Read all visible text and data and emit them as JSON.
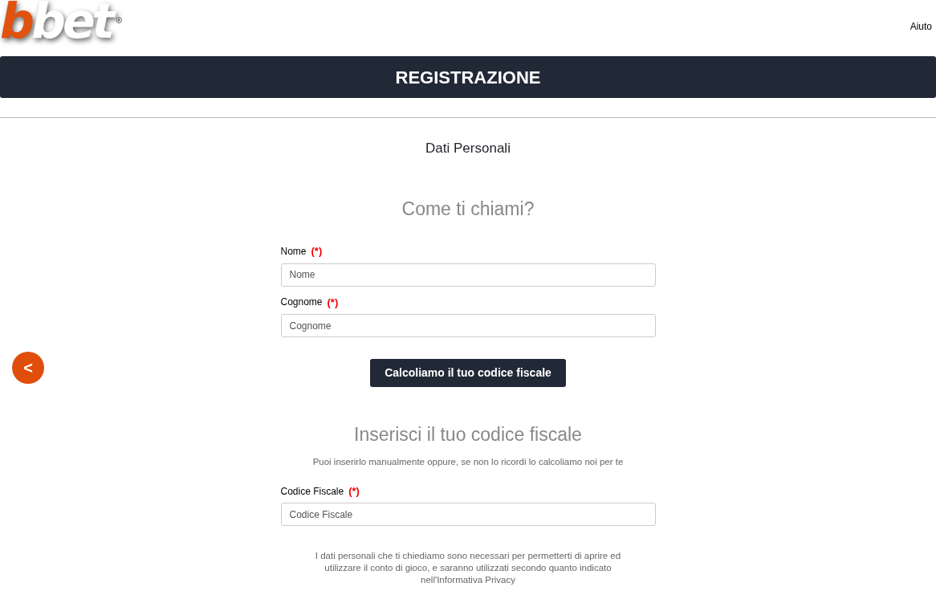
{
  "header": {
    "logo": {
      "first": "b",
      "rest": "bet",
      "mark": "®"
    },
    "help_link": "Aiuto"
  },
  "title_bar": "REGISTRAZIONE",
  "step": "Dati Personali",
  "sections": [
    {
      "heading": "Come ti chiami?",
      "fields": [
        {
          "label": "Nome",
          "required": "(*)",
          "placeholder": "Nome"
        },
        {
          "label": "Cognome",
          "required": "(*)",
          "placeholder": "Cognome"
        }
      ],
      "button": "Calcoliamo il tuo codice fiscale"
    },
    {
      "heading": "Inserisci il tuo codice fiscale",
      "hint": "Puoi inserirlo manualmente oppure, se non lo ricordi lo calcoliamo noi per te",
      "fields": [
        {
          "label": "Codice Fiscale",
          "required": "(*)",
          "placeholder": "Codice Fiscale"
        }
      ]
    }
  ],
  "privacy_note": "I dati personali che ti chiediamo sono necessari per permetterti di aprire ed utilizzare il conto di gioco, e saranno utilizzati secondo quanto indicato nell'Informativa Privacy",
  "back_button": "<"
}
